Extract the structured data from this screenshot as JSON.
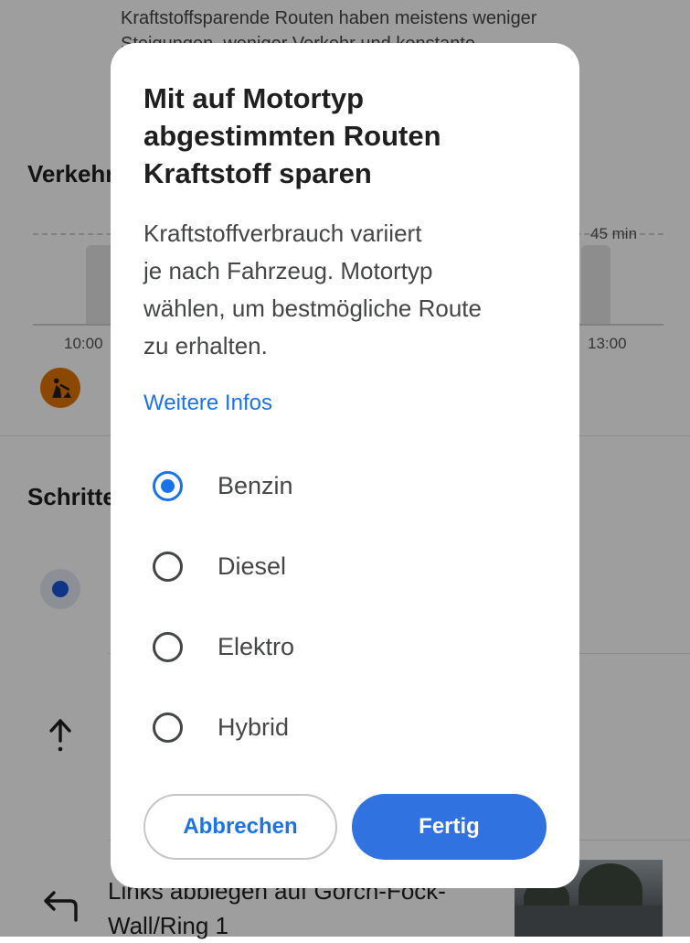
{
  "background": {
    "description": "Kraftstoffsparende Routen haben meistens weniger Steigungen, weniger Verkehr und konstante",
    "traffic_heading": "Verkehr",
    "chart": {
      "top_label": "45 min",
      "time_start": "10:00",
      "time_end": "13:00"
    },
    "steps_heading": "Schritte",
    "step_text": "Links abbiegen auf Gorch-Fock-Wall/Ring 1",
    "icons": {
      "construction": "construction-icon",
      "location": "location-dot-icon",
      "straight": "arrow-up-icon",
      "turn_left": "turn-left-icon"
    }
  },
  "dialog": {
    "title": "Mit auf Motortyp abgestimmten Routen Kraftstoff sparen",
    "title_lines": [
      "Mit auf Motortyp",
      "abgestimmten Routen",
      "Kraftstoff sparen"
    ],
    "body_lines": [
      "Kraftstoffverbrauch variiert",
      "je nach Fahrzeug. Motortyp",
      "wählen, um bestmögliche Route",
      "zu erhalten."
    ],
    "more_info": "Weitere Infos",
    "options": [
      {
        "label": "Benzin",
        "selected": true
      },
      {
        "label": "Diesel",
        "selected": false
      },
      {
        "label": "Elektro",
        "selected": false
      },
      {
        "label": "Hybrid",
        "selected": false
      }
    ],
    "cancel_label": "Abbrechen",
    "done_label": "Fertig"
  },
  "colors": {
    "accent": "#1a73e8",
    "primary_button": "#2f72e0",
    "construction_badge": "#e37400",
    "location_dot": "#1a56d6"
  }
}
